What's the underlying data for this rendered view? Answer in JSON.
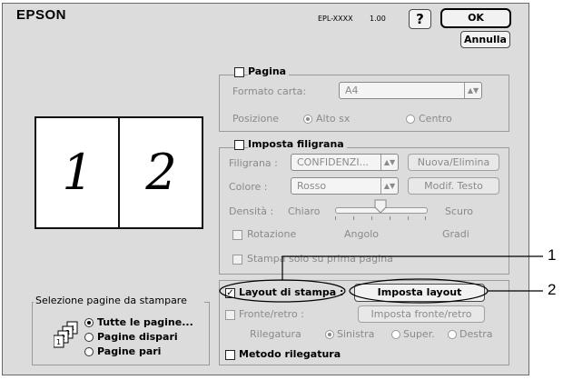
{
  "header": {
    "brand": "EPSON",
    "model": "EPL-XXXX",
    "version": "1.00",
    "help_label": "?",
    "ok_label": "OK",
    "cancel_label": "Annulla"
  },
  "preview": {
    "page_left": "1",
    "page_right": "2"
  },
  "pagina": {
    "title": "Pagina",
    "paper_size_label": "Formato carta:",
    "paper_size_value": "A4",
    "position_label": "Posizione",
    "position_options": [
      "Alto sx",
      "Centro"
    ],
    "position_selected": "Alto sx"
  },
  "filigrana": {
    "title": "Imposta filigrana",
    "watermark_label": "Filigrana :",
    "watermark_value": "CONFIDENZI...",
    "new_delete_label": "Nuova/Elimina",
    "color_label": "Colore :",
    "color_value": "Rosso",
    "edit_text_label": "Modif. Testo",
    "density_label": "Densità :",
    "density_light": "Chiaro",
    "density_dark": "Scuro",
    "density_level": 0.5,
    "rotation_label": "Rotazione",
    "angle_label": "Angolo",
    "degrees_label": "Gradi",
    "first_page_only_label": "Stampa solo su prima pagina"
  },
  "layout": {
    "print_layout_label": "Layout di stampa :",
    "print_layout_checked": true,
    "layout_settings_label": "Imposta layout",
    "duplex_label": "Fronte/retro :",
    "duplex_settings_label": "Imposta fronte/retro",
    "binding_label": "Rilegatura",
    "binding_options": [
      "Sinistra",
      "Super.",
      "Destra"
    ],
    "binding_selected": "Sinistra",
    "binding_method_label": "Metodo rilegatura"
  },
  "page_selection": {
    "title": "Selezione pagine da stampare",
    "options": [
      "Tutte le pagine...",
      "Pagine dispari",
      "Pagine pari"
    ],
    "selected": "Tutte le pagine..."
  },
  "callouts": [
    "1",
    "2"
  ]
}
